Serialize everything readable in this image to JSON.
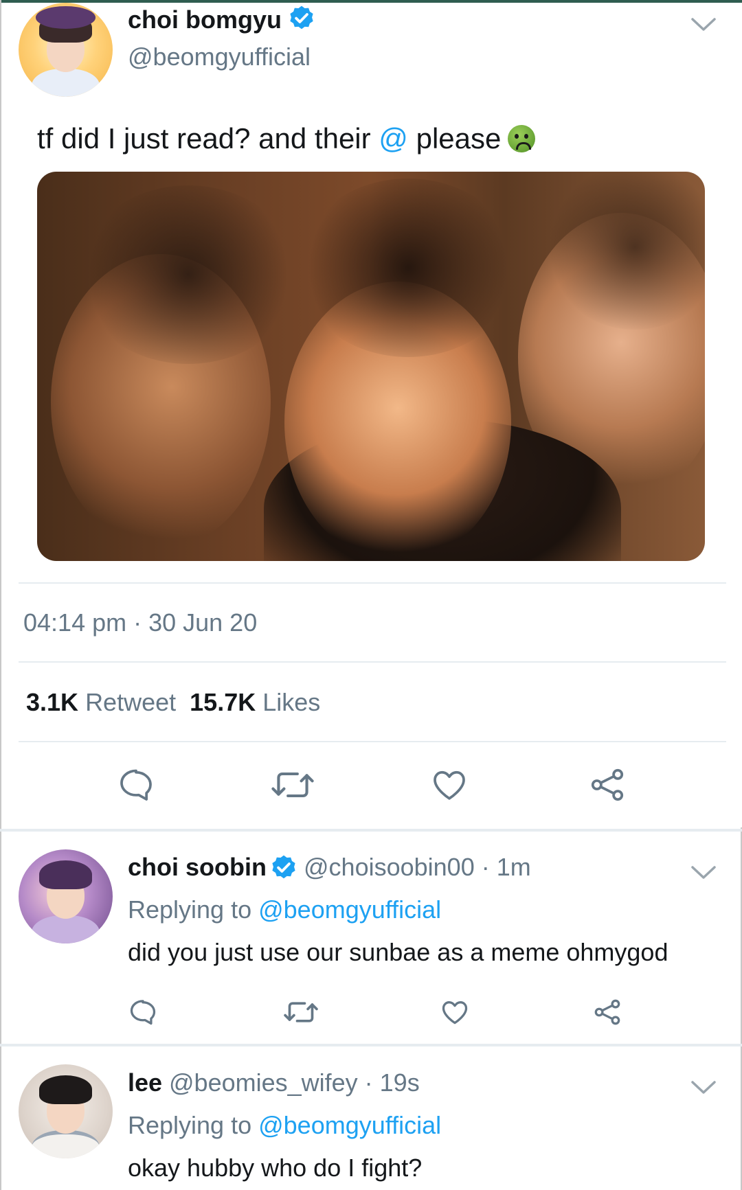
{
  "main_tweet": {
    "name": "choi bomgyu",
    "handle": "@beomgyufficial",
    "text_before_mention": "tf did I just read? and their ",
    "mention": "@",
    "text_after_mention": " please",
    "emoji": "nauseated-face-emoji",
    "timestamp": "04:14 pm · 30 Jun 20",
    "retweet_count": "3.1K",
    "retweet_label": "Retweet",
    "like_count": "15.7K",
    "like_label": "Likes"
  },
  "replies": [
    {
      "name": "choi soobin",
      "handle_time": "@choisoobin00 · 1m",
      "replying_prefix": "Replying to ",
      "replying_handle": "@beomgyufficial",
      "text": "did you just use our sunbae as a meme ohmygod"
    },
    {
      "name": "lee",
      "handle_time": "@beomies_wifey · 19s",
      "replying_prefix": "Replying to ",
      "replying_handle": "@beomgyufficial",
      "text": "okay hubby who do I fight?"
    }
  ],
  "icons": [
    "verified-badge-icon",
    "chevron-down-icon",
    "reply-icon",
    "retweet-icon",
    "like-icon",
    "share-icon"
  ],
  "colors": {
    "accent": "#1da1f2",
    "text": "#14171a",
    "secondary": "#657786",
    "divider": "#e6ecf0",
    "top_bar": "#2f5d50"
  }
}
